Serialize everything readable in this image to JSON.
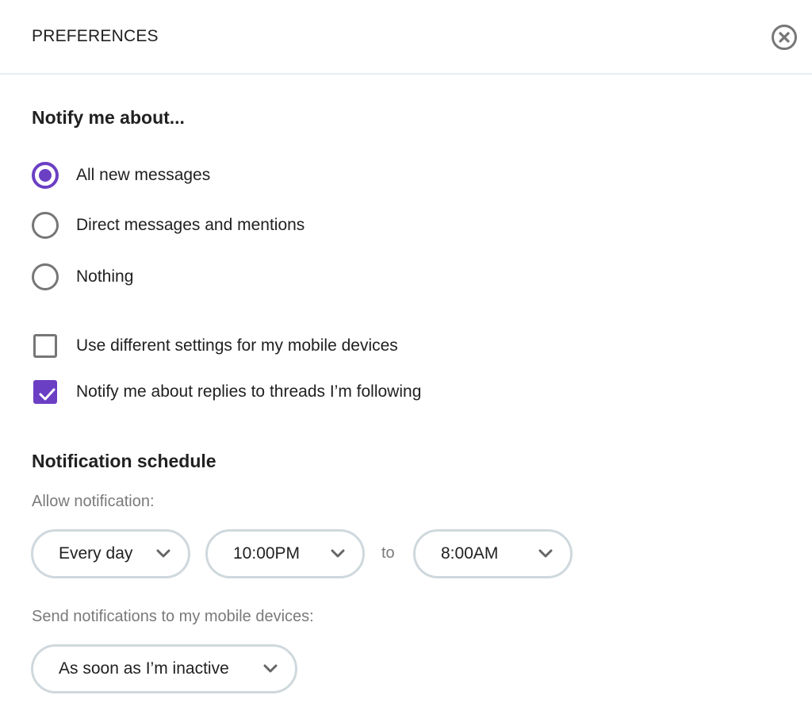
{
  "header": {
    "title": "PREFERENCES",
    "close_icon": "close-circle-icon"
  },
  "notify": {
    "title": "Notify me about...",
    "options": [
      {
        "label": "All new messages",
        "checked": true
      },
      {
        "label": "Direct messages and mentions",
        "checked": false
      },
      {
        "label": "Nothing",
        "checked": false
      }
    ],
    "checkboxes": [
      {
        "label": "Use different settings for my mobile devices",
        "checked": false
      },
      {
        "label": "Notify me about replies to threads I’m following",
        "checked": true
      }
    ]
  },
  "schedule": {
    "title": "Notification schedule",
    "allow_label": "Allow notification:",
    "days_value": "Every day",
    "from_value": "10:00PM",
    "to_label": "to",
    "to_value": "8:00AM",
    "mobile_label": "Send notifications to my mobile devices:",
    "mobile_value": "As soon as I’m inactive"
  },
  "colors": {
    "accent": "#6b3fc4",
    "border": "#cfd8dd",
    "muted_text": "#7a7a7a"
  }
}
